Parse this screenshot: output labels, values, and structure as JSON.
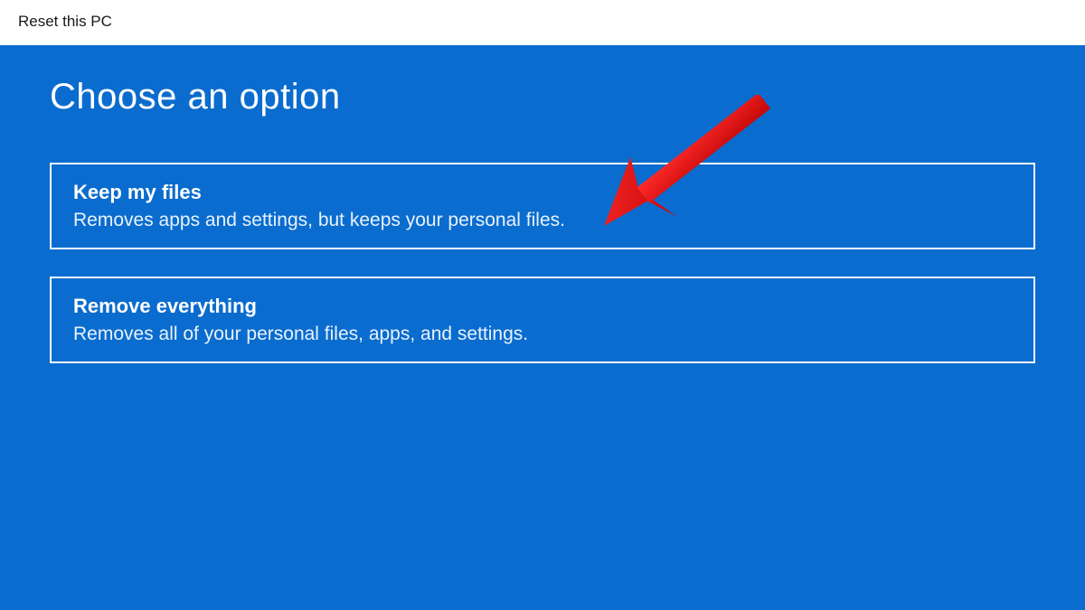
{
  "window": {
    "title": "Reset this PC"
  },
  "main": {
    "heading": "Choose an option",
    "options": [
      {
        "title": "Keep my files",
        "description": "Removes apps and settings, but keeps your personal files."
      },
      {
        "title": "Remove everything",
        "description": "Removes all of your personal files, apps, and settings."
      }
    ]
  },
  "annotation": {
    "arrow_color": "#e81010"
  }
}
